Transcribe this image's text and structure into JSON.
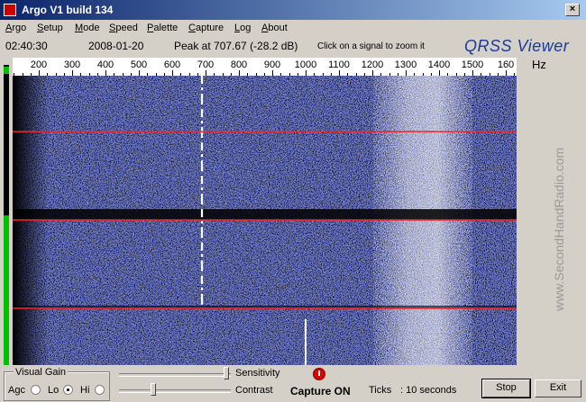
{
  "window": {
    "title": "Argo V1 build 134",
    "close_glyph": "×"
  },
  "menu": [
    {
      "pre": "",
      "key": "A",
      "rest": "rgo"
    },
    {
      "pre": "",
      "key": "S",
      "rest": "etup"
    },
    {
      "pre": "",
      "key": "M",
      "rest": "ode"
    },
    {
      "pre": "",
      "key": "S",
      "rest": "peed"
    },
    {
      "pre": "",
      "key": "P",
      "rest": "alette"
    },
    {
      "pre": "",
      "key": "C",
      "rest": "apture"
    },
    {
      "pre": "",
      "key": "L",
      "rest": "og"
    },
    {
      "pre": "",
      "key": "A",
      "rest": "bout"
    }
  ],
  "info": {
    "time": "02:40:30",
    "date": "2008-01-20",
    "peak": "Peak at 707.67 (-28.2 dB)",
    "hint": "Click on a signal to zoom it"
  },
  "brand": "QRSS Viewer",
  "scale": {
    "unit": "Hz",
    "labels": [
      "200",
      "300",
      "400",
      "500",
      "600",
      "700",
      "800",
      "900",
      "1000",
      "1100",
      "1200",
      "1300",
      "1400",
      "1500",
      "160"
    ]
  },
  "watermark": "www.SecondHandRadio.com",
  "level_meter": {
    "level_fraction": 0.5
  },
  "visual_gain": {
    "title": "Visual Gain",
    "options": [
      "Agc",
      "Lo",
      "Hi"
    ],
    "selected": "Lo"
  },
  "sliders": {
    "sensitivity": {
      "label": "Sensitivity",
      "level_fraction": 0.98
    },
    "contrast": {
      "label": "Contrast",
      "level_fraction": 0.3
    }
  },
  "capture": {
    "status": "Capture ON",
    "ticks_label": "Ticks",
    "ticks_value": ": 10 seconds"
  },
  "buttons": {
    "stop": "Stop",
    "exit": "Exit"
  },
  "colors": {
    "title_bar": "#0a246a",
    "spectrogram_bg": "#000000",
    "noise": "#1e2a9e",
    "marker_line": "#ff2020",
    "brand": "#1a3a9a"
  }
}
